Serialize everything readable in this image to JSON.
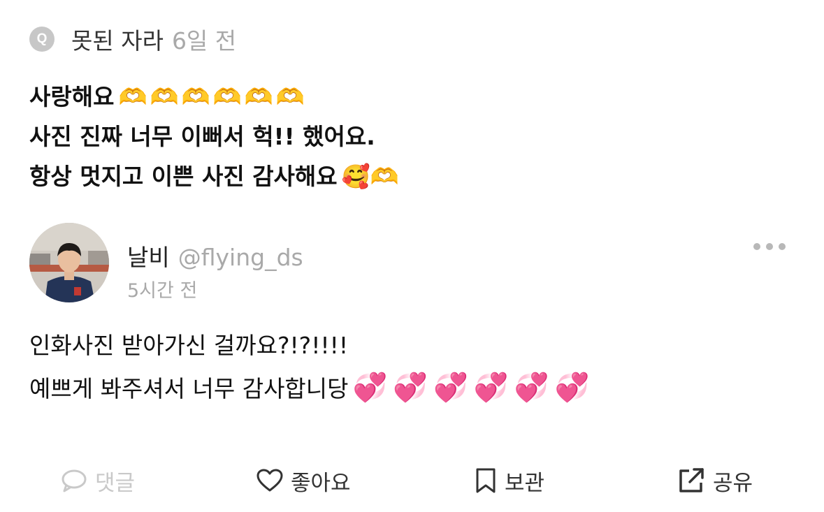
{
  "question": {
    "badge": "Q",
    "author": "못된 자라",
    "time": "6일 전",
    "lines": [
      {
        "text": "사랑해요",
        "emoji": "🫶🫶🫶🫶🫶🫶"
      },
      {
        "text": "사진 진짜 너무 이뻐서 헉!! 했어요.",
        "emoji": ""
      },
      {
        "text": "항상 멋지고 이쁜 사진 감사해요",
        "emoji": "🥰🫶"
      }
    ]
  },
  "answer": {
    "name": "날비",
    "handle": "@flying_ds",
    "time": "5시간 전",
    "lines": [
      {
        "text": "인화사진 받아가신 걸까요?!?!!!!",
        "emoji": ""
      },
      {
        "text": "예쁘게 봐주셔서 너무 감사합니당",
        "emoji": "💞💞💞💞💞💞"
      }
    ]
  },
  "actions": {
    "comment": "댓글",
    "like": "좋아요",
    "save": "보관",
    "share": "공유"
  },
  "icons": {
    "more": "more-horizontal-icon",
    "comment": "speech-bubble-icon",
    "like": "heart-outline-icon",
    "save": "bookmark-icon",
    "share": "share-external-icon"
  },
  "colors": {
    "muted": "#a9a9a9",
    "disabled": "#c9c9c9",
    "text": "#111111"
  }
}
